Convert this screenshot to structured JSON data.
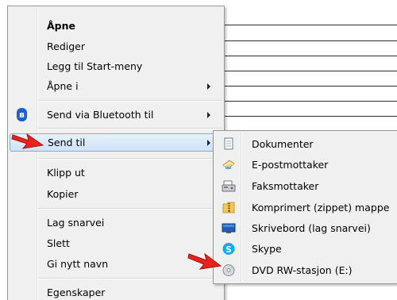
{
  "menu": {
    "items": [
      {
        "label": "Åpne"
      },
      {
        "label": "Rediger"
      },
      {
        "label": "Legg til Start-meny"
      },
      {
        "label": "Åpne i"
      },
      {
        "label": "Send via Bluetooth til"
      },
      {
        "label": "Send til"
      },
      {
        "label": "Klipp ut"
      },
      {
        "label": "Kopier"
      },
      {
        "label": "Lag snarvei"
      },
      {
        "label": "Slett"
      },
      {
        "label": "Gi nytt navn"
      },
      {
        "label": "Egenskaper"
      }
    ]
  },
  "submenu": {
    "items": [
      {
        "label": "Dokumenter",
        "icon": "documents-icon"
      },
      {
        "label": "E-postmottaker",
        "icon": "mail-recipient-icon"
      },
      {
        "label": "Faksmottaker",
        "icon": "fax-icon"
      },
      {
        "label": "Komprimert (zippet) mappe",
        "icon": "zip-folder-icon"
      },
      {
        "label": "Skrivebord (lag snarvei)",
        "icon": "desktop-icon"
      },
      {
        "label": "Skype",
        "icon": "skype-icon"
      },
      {
        "label": "DVD RW-stasjon (E:)",
        "icon": "dvd-drive-icon"
      }
    ]
  },
  "colors": {
    "menu_bg": "#f0f0f0",
    "highlight_border": "#84acdd",
    "red_arrow": "#e8231b",
    "bluetooth": "#1a5fcf",
    "skype": "#00aff0"
  }
}
